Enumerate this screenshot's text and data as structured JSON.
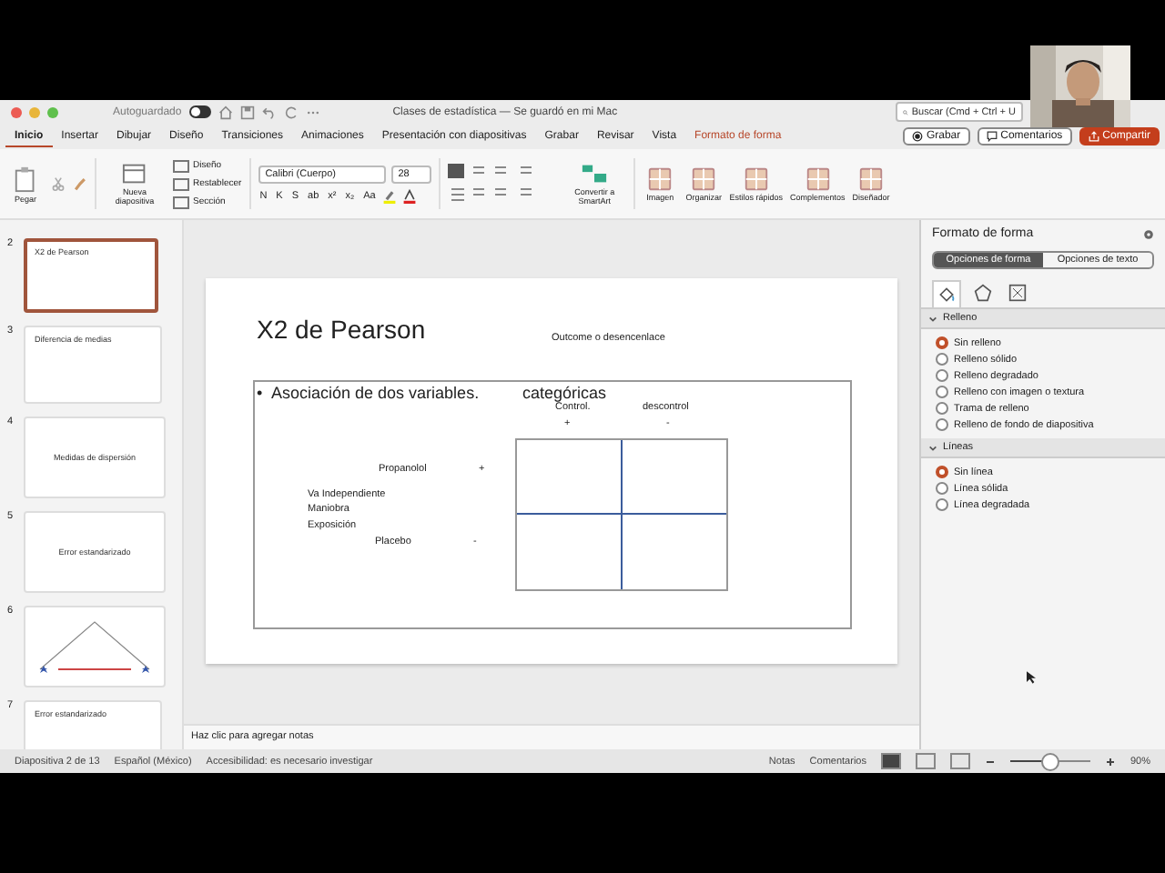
{
  "window": {
    "autosave_label": "Autoguardado",
    "autosave_on": false,
    "title": "Clases de estadística — Se guardó en mi Mac",
    "search": {
      "placeholder": "Buscar (Cmd + Ctrl + U"
    }
  },
  "tabs": [
    {
      "label": "Inicio",
      "selected": true,
      "kind": "normal"
    },
    {
      "label": "Insertar",
      "selected": false,
      "kind": "normal"
    },
    {
      "label": "Dibujar",
      "selected": false,
      "kind": "normal"
    },
    {
      "label": "Diseño",
      "selected": false,
      "kind": "normal"
    },
    {
      "label": "Transiciones",
      "selected": false,
      "kind": "normal"
    },
    {
      "label": "Animaciones",
      "selected": false,
      "kind": "normal"
    },
    {
      "label": "Presentación con diapositivas",
      "selected": false,
      "kind": "normal"
    },
    {
      "label": "Grabar",
      "selected": false,
      "kind": "normal"
    },
    {
      "label": "Revisar",
      "selected": false,
      "kind": "normal"
    },
    {
      "label": "Vista",
      "selected": false,
      "kind": "normal"
    },
    {
      "label": "Formato de forma",
      "selected": false,
      "kind": "contextual"
    }
  ],
  "header_buttons": [
    {
      "label": "Grabar",
      "kind": "record"
    },
    {
      "label": "Comentarios",
      "kind": "comments"
    },
    {
      "label": "Compartir",
      "kind": "share"
    }
  ],
  "ribbon": {
    "paste": "Pegar",
    "new_slide": "Nueva diapositiva",
    "slide_actions": [
      "Diseño",
      "Restablecer",
      "Sección"
    ],
    "font": "Calibri (Cuerpo)",
    "size": "28",
    "format_keys": [
      "N",
      "K",
      "S",
      "ab",
      "x²",
      "x₂"
    ],
    "case_key": "Aa",
    "smartart": "Convertir a SmartArt",
    "big_buttons": [
      "Imagen",
      "Organizar",
      "Estilos rápidos",
      "Complementos",
      "Diseñador"
    ]
  },
  "thumbnails": [
    {
      "number": "2",
      "title": "X2 de Pearson",
      "selected": true,
      "kind": "top"
    },
    {
      "number": "3",
      "title": "Diferencia de medias",
      "selected": false,
      "kind": "top"
    },
    {
      "number": "4",
      "title": "Medidas de dispersión",
      "selected": false,
      "kind": "center"
    },
    {
      "number": "5",
      "title": "Error estandarizado",
      "selected": false,
      "kind": "center"
    },
    {
      "number": "6",
      "selected": false,
      "kind": "drawing"
    },
    {
      "number": "7",
      "title": "Error estandarizado",
      "selected": false,
      "kind": "top"
    }
  ],
  "slide": {
    "title": "X2 de Pearson",
    "outcome_label": "Outcome o desencenlace",
    "bullet_mark": "•",
    "bullet": "Asociación de dos variables.",
    "bullet_tail": "categóricas",
    "columns": [
      {
        "label": "Control.",
        "sign": "+"
      },
      {
        "label": "descontrol",
        "sign": "-"
      }
    ],
    "rows": [
      {
        "label": "Propanolol",
        "sign": "+"
      },
      {
        "label": "Placebo",
        "sign": "-"
      }
    ],
    "side_labels": [
      "Va Independiente",
      "Maniobra",
      "Exposición"
    ]
  },
  "notes": {
    "placeholder": "Haz clic para agregar notas"
  },
  "panel": {
    "title": "Formato de forma",
    "tabs": [
      {
        "label": "Opciones de forma",
        "selected": true
      },
      {
        "label": "Opciones de texto",
        "selected": false
      }
    ],
    "sections": [
      {
        "title": "Relleno",
        "expanded": true,
        "options": [
          {
            "label": "Sin relleno",
            "selected": true
          },
          {
            "label": "Relleno sólido",
            "selected": false
          },
          {
            "label": "Relleno degradado",
            "selected": false
          },
          {
            "label": "Relleno con imagen o textura",
            "selected": false
          },
          {
            "label": "Trama de relleno",
            "selected": false
          },
          {
            "label": "Relleno de fondo de diapositiva",
            "selected": false
          }
        ]
      },
      {
        "title": "Líneas",
        "expanded": true,
        "options": [
          {
            "label": "Sin línea",
            "selected": true
          },
          {
            "label": "Línea sólida",
            "selected": false
          },
          {
            "label": "Línea degradada",
            "selected": false
          }
        ]
      }
    ]
  },
  "status": {
    "left": [
      "Diapositiva 2 de 13",
      "Español (México)",
      "Accesibilidad: es necesario investigar"
    ],
    "notes": "Notas",
    "comments": "Comentarios",
    "zoom": "90%",
    "zoom_slider": {
      "level": 0.5
    }
  }
}
